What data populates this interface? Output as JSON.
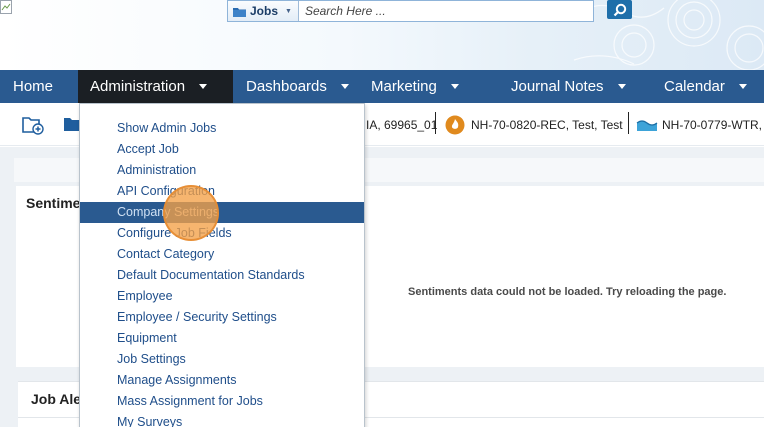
{
  "header": {
    "search": {
      "scope_label": "Jobs",
      "placeholder": "Search Here ..."
    }
  },
  "nav": {
    "items": [
      {
        "label": "Home"
      },
      {
        "label": "Administration"
      },
      {
        "label": "Dashboards"
      },
      {
        "label": "Marketing"
      },
      {
        "label": "Journal Notes"
      },
      {
        "label": "Calendar"
      }
    ]
  },
  "recent_jobs": [
    {
      "label": "IA, 69965_01",
      "icon": "document-icon"
    },
    {
      "label": "NH-70-0820-REC, Test, Test",
      "icon": "fire-icon"
    },
    {
      "label": "NH-70-0779-WTR,",
      "icon": "water-icon"
    }
  ],
  "admin_menu": {
    "items": [
      {
        "label": "Show Admin Jobs"
      },
      {
        "label": "Accept Job"
      },
      {
        "label": "Administration"
      },
      {
        "label": "API Configuration"
      },
      {
        "label": "Company Settings"
      },
      {
        "label": "Configure Job Fields"
      },
      {
        "label": "Contact Category"
      },
      {
        "label": "Default Documentation Standards"
      },
      {
        "label": "Employee"
      },
      {
        "label": "Employee / Security Settings"
      },
      {
        "label": "Equipment"
      },
      {
        "label": "Job Settings"
      },
      {
        "label": "Manage Assignments"
      },
      {
        "label": "Mass Assignment for Jobs"
      },
      {
        "label": "My Surveys"
      }
    ],
    "highlighted": "Company Settings"
  },
  "sentiments_panel": {
    "title": "Sentime",
    "message": "Sentiments data could not be loaded. Try reloading the page."
  },
  "job_alerts_panel": {
    "title": "Job Aler"
  },
  "colors": {
    "nav_bg": "#2a5a90",
    "nav_active_bg": "#1b1f24",
    "link": "#1f4e8a",
    "page_bg": "#edf1f5"
  }
}
